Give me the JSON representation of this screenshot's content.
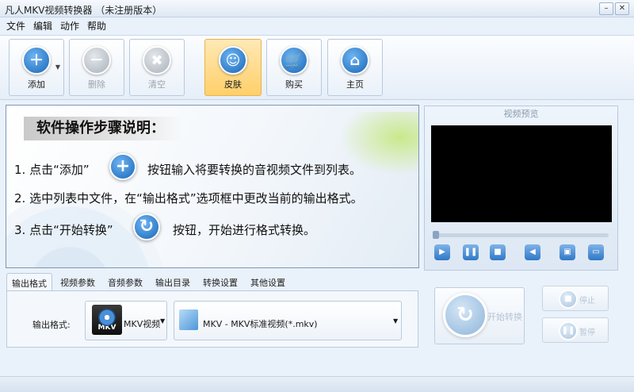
{
  "window": {
    "title": "凡人MKV视频转换器 （未注册版本）"
  },
  "window_buttons": {
    "minimize": "–",
    "close": "✕"
  },
  "menu": [
    "文件",
    "编辑",
    "动作",
    "帮助"
  ],
  "toolbar": {
    "add": "添加",
    "delete": "删除",
    "clear": "清空",
    "skin": "皮肤",
    "buy": "购买",
    "home": "主页"
  },
  "guide": {
    "title": "软件操作步骤说明：",
    "step1_a": "1. 点击“添加”",
    "step1_b": "按钮输入将要转换的音视频文件到列表。",
    "step2": "2. 选中列表中文件，在“输出格式”选项框中更改当前的输出格式。",
    "step3_a": "3. 点击“开始转换”",
    "step3_b": "按钮，开始进行格式转换。"
  },
  "preview": {
    "title": "视频预览"
  },
  "tabs": [
    "输出格式",
    "视频参数",
    "音频参数",
    "输出目录",
    "转换设置",
    "其他设置"
  ],
  "output": {
    "label": "输出格式:",
    "format_name": "MKV视频",
    "format_icon_caption": "MKV",
    "preset": "MKV - MKV标准视频(*.mkv)"
  },
  "actions": {
    "start": "开始转换",
    "stop": "停止",
    "pause": "暂停"
  },
  "colors": {
    "accent": "#1766b8",
    "skin_highlight": "#ffcf6a",
    "screen": "#000000"
  }
}
